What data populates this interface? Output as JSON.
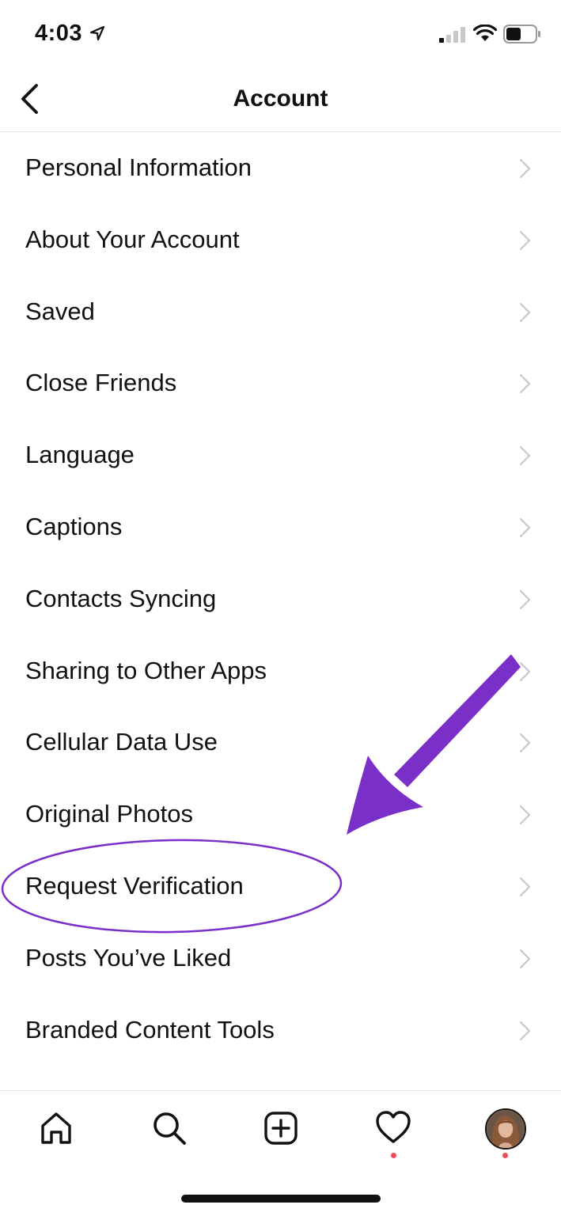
{
  "status_bar": {
    "time": "4:03"
  },
  "header": {
    "title": "Account"
  },
  "menu": {
    "items": [
      {
        "label": "Personal Information"
      },
      {
        "label": "About Your Account"
      },
      {
        "label": "Saved"
      },
      {
        "label": "Close Friends"
      },
      {
        "label": "Language"
      },
      {
        "label": "Captions"
      },
      {
        "label": "Contacts Syncing"
      },
      {
        "label": "Sharing to Other Apps"
      },
      {
        "label": "Cellular Data Use"
      },
      {
        "label": "Original Photos"
      },
      {
        "label": "Request Verification",
        "highlighted": true
      },
      {
        "label": "Posts You’ve Liked"
      },
      {
        "label": "Branded Content Tools"
      }
    ]
  },
  "annotation": {
    "color": "#7b2fc9",
    "target": "Request Verification"
  },
  "tab_bar": {
    "tabs": [
      {
        "icon": "home-icon"
      },
      {
        "icon": "search-icon"
      },
      {
        "icon": "new-post-icon"
      },
      {
        "icon": "heart-icon",
        "notification": true
      },
      {
        "icon": "profile-avatar",
        "notification": true
      }
    ],
    "notification_color": "#ed4956"
  }
}
